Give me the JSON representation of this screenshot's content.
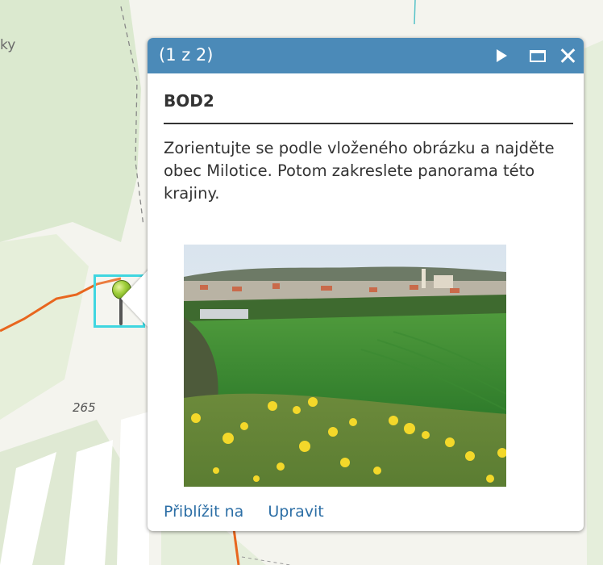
{
  "map": {
    "place_label_fragment": "ky",
    "elevation_label": "265"
  },
  "popup": {
    "counter": "(1 z 2)",
    "title": "BOD2",
    "description": "Zorientujte se podle vloženého obrázku a najděte obec Milotice. Potom zakreslete panorama této krajiny.",
    "actions": {
      "zoom_to": "Přiblížit na",
      "edit": "Upravit"
    }
  },
  "colors": {
    "header": "#4b8ab8",
    "link": "#2d6fa6",
    "marker_highlight": "#3fd6e0",
    "route": "#e8661e"
  },
  "icons": [
    "next-arrow-icon",
    "maximize-icon",
    "close-icon",
    "map-pin-icon"
  ]
}
